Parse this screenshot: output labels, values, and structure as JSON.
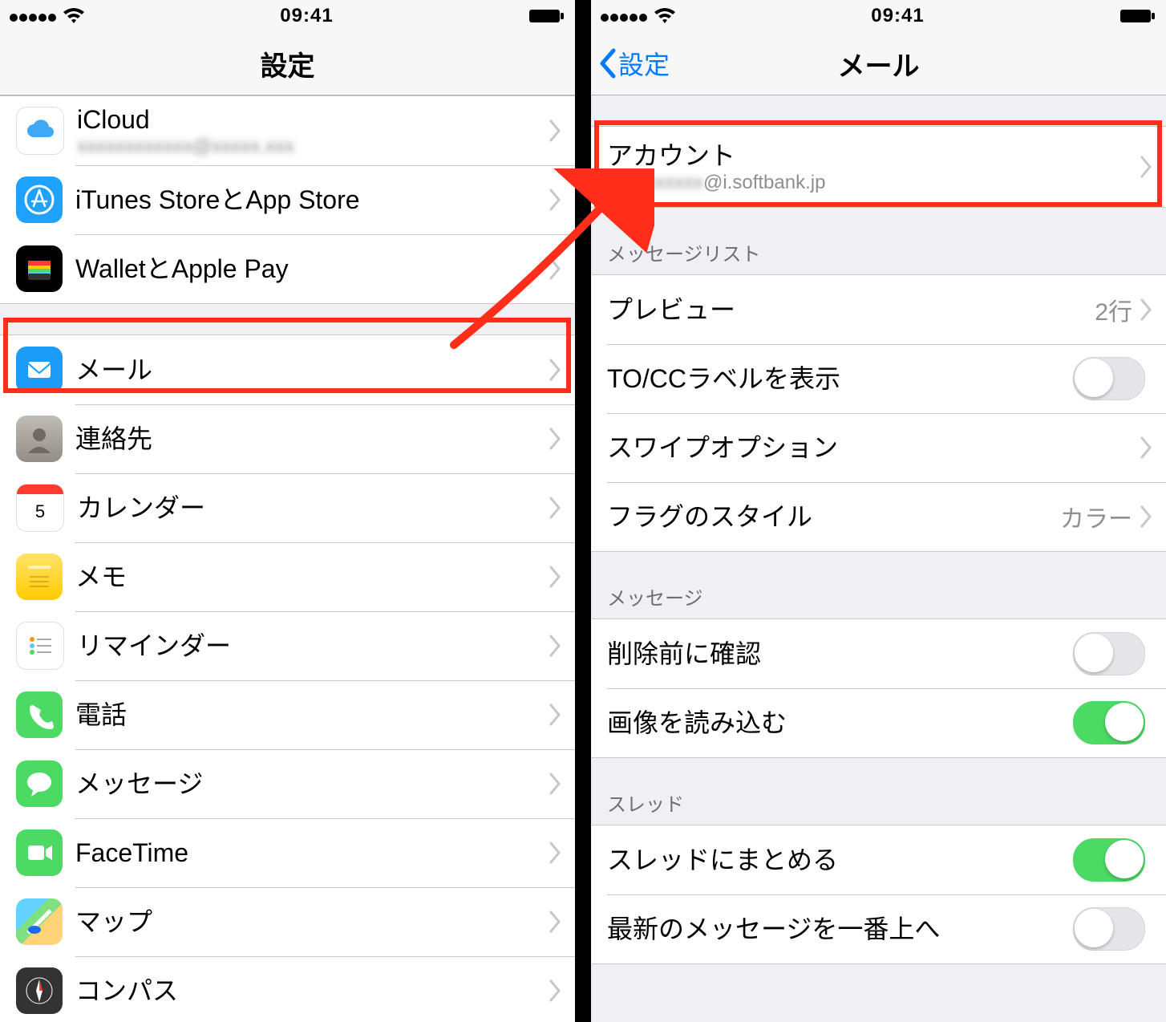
{
  "statusbar": {
    "time": "09:41"
  },
  "left": {
    "nav_title": "設定",
    "group1": [
      {
        "label": "iCloud",
        "sub": "xxxxxxxxxxxx@xxxxx.xxx"
      },
      {
        "label": "iTunes StoreとApp Store"
      },
      {
        "label": "WalletとApple Pay"
      }
    ],
    "group2": [
      {
        "label": "メール"
      },
      {
        "label": "連絡先"
      },
      {
        "label": "カレンダー"
      },
      {
        "label": "メモ"
      },
      {
        "label": "リマインダー"
      },
      {
        "label": "電話"
      },
      {
        "label": "メッセージ"
      },
      {
        "label": "FaceTime"
      },
      {
        "label": "マップ"
      },
      {
        "label": "コンパス"
      }
    ]
  },
  "right": {
    "nav_back": "設定",
    "nav_title": "メール",
    "account": {
      "label": "アカウント",
      "sub_blurred": "xxxxxxxxxx",
      "sub_clear": "@i.softbank.jp"
    },
    "section_list": "メッセージリスト",
    "preview": {
      "label": "プレビュー",
      "detail": "2行"
    },
    "tocc": {
      "label": "TO/CCラベルを表示"
    },
    "swipe": {
      "label": "スワイプオプション"
    },
    "flag": {
      "label": "フラグのスタイル",
      "detail": "カラー"
    },
    "section_message": "メッセージ",
    "confirm_delete": {
      "label": "削除前に確認"
    },
    "load_images": {
      "label": "画像を読み込む"
    },
    "section_thread": "スレッド",
    "thread_group": {
      "label": "スレッドにまとめる"
    },
    "newest_top": {
      "label": "最新のメッセージを一番上へ"
    }
  }
}
